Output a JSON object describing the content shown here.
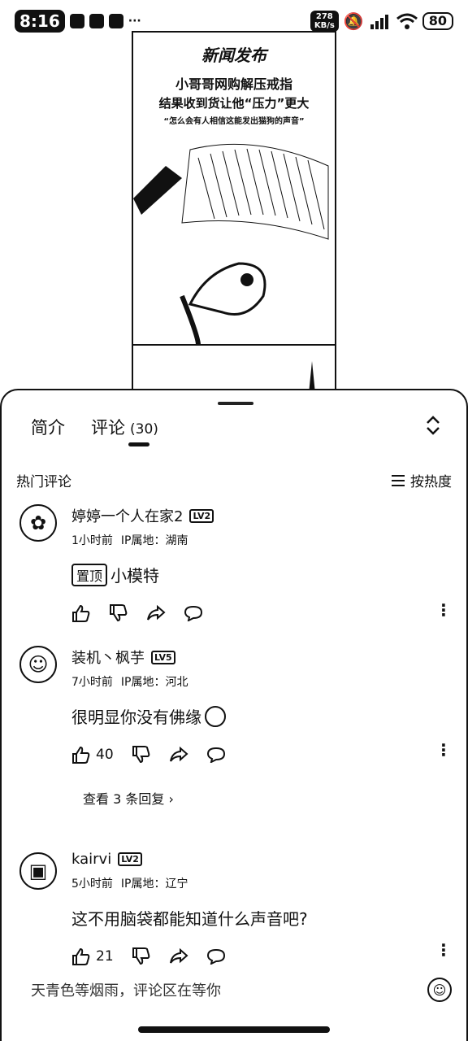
{
  "status": {
    "time": "8:16",
    "net_speed_value": "278",
    "net_speed_unit": "KB/s",
    "battery": "80"
  },
  "video": {
    "logo": "新闻发布",
    "title_line1": "小哥哥网购解压戒指",
    "title_line2": "结果收到货让他“压力”更大",
    "title_line3": "“怎么会有人相信这能发出猫狗的声音”"
  },
  "tabs": {
    "intro": "简介",
    "comments": "评论",
    "comment_count": "(30)"
  },
  "section": {
    "title": "热门评论",
    "sort_label": "按热度"
  },
  "comments": [
    {
      "name": "婷婷一个人在家2",
      "level": "LV2",
      "time": "1小时前",
      "ip": "IP属地：湖南",
      "pinned": "置顶",
      "text": "小模特",
      "likes": ""
    },
    {
      "name": "装机丶枫芋",
      "level": "LV5",
      "time": "7小时前",
      "ip": "IP属地：河北",
      "text": "很明显你没有佛缘",
      "likes": "40",
      "replies": "查看 3 条回复 ›"
    },
    {
      "name": "kairvi",
      "level": "LV2",
      "time": "5小时前",
      "ip": "IP属地：辽宁",
      "text": "这不用脑袋都能知道什么声音吧?",
      "likes": "21"
    }
  ],
  "input": {
    "placeholder": "天青色等烟雨，评论区在等你"
  }
}
